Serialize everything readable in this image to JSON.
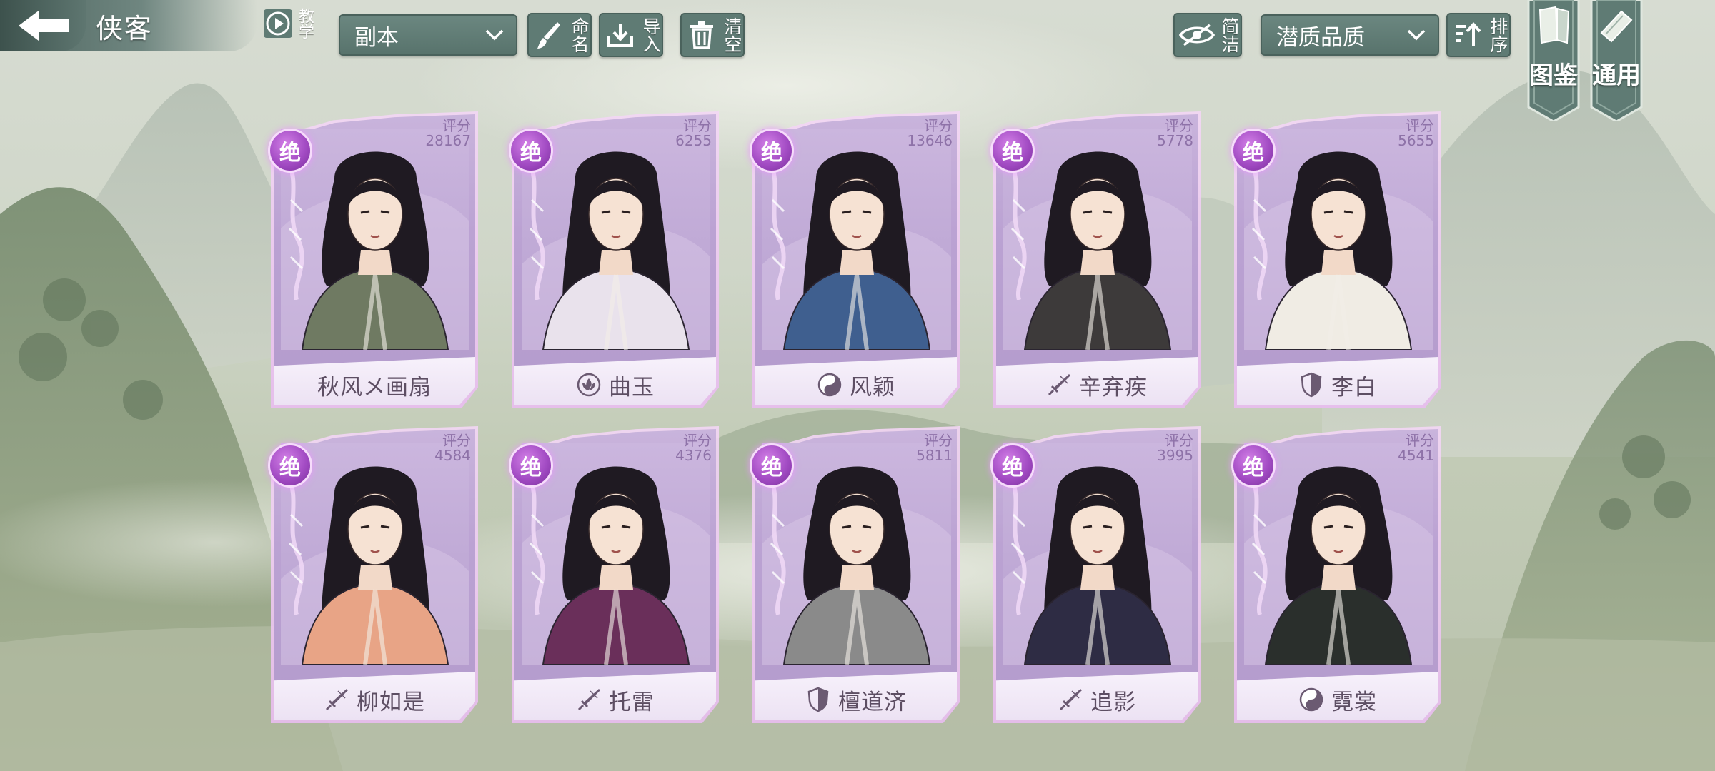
{
  "header": {
    "back_title": "侠客",
    "tutorial_label": "教学",
    "mode_select": {
      "selected": "副本"
    },
    "rename_label": "命名",
    "import_label": "导入",
    "clear_label": "清空",
    "simple_label": "简洁",
    "sort_select": {
      "selected": "潜质品质"
    },
    "order_label": "排序",
    "codex_label": "图鉴",
    "general_label": "通用"
  },
  "colors": {
    "toolbar": "#5f7b74",
    "card_frame": "#bba2d3",
    "rank_badge": "#a34cc4",
    "score_text": "#8e72a8",
    "name_text": "#5d4e63"
  },
  "heroes": [
    {
      "rank": "绝",
      "score_label": "评分",
      "score": "28167",
      "name": "秋风メ画扇",
      "sect_icon": "none",
      "art": "green-robed-swordsman",
      "theme": "#6f7a62"
    },
    {
      "rank": "绝",
      "score_label": "评分",
      "score": "6255",
      "name": "曲玉",
      "sect_icon": "lotus-icon",
      "art": "white-bride-maiden",
      "theme": "#e9e2ec"
    },
    {
      "rank": "绝",
      "score_label": "评分",
      "score": "13646",
      "name": "风颖",
      "sect_icon": "taiji-icon",
      "art": "blue-armored-heroine",
      "theme": "#3f5f8f"
    },
    {
      "rank": "绝",
      "score_label": "评分",
      "score": "5778",
      "name": "辛弃疾",
      "sect_icon": "sword-icon",
      "art": "dark-robed-swordsman",
      "theme": "#3d3a3a"
    },
    {
      "rank": "绝",
      "score_label": "评分",
      "score": "5655",
      "name": "李白",
      "sect_icon": "shield-icon",
      "art": "white-robed-poet",
      "theme": "#f0ece4"
    },
    {
      "rank": "绝",
      "score_label": "评分",
      "score": "4584",
      "name": "柳如是",
      "sect_icon": "sword-icon",
      "art": "peach-robed-lady",
      "theme": "#e8a486"
    },
    {
      "rank": "绝",
      "score_label": "评分",
      "score": "4376",
      "name": "托雷",
      "sect_icon": "sword-icon",
      "art": "fur-caped-warrior",
      "theme": "#6a2f5a"
    },
    {
      "rank": "绝",
      "score_label": "评分",
      "score": "5811",
      "name": "檀道济",
      "sect_icon": "shield-icon",
      "art": "silver-armored-general",
      "theme": "#8a8a8a"
    },
    {
      "rank": "绝",
      "score_label": "评分",
      "score": "3995",
      "name": "追影",
      "sect_icon": "sword-icon",
      "art": "dark-assassin-woman",
      "theme": "#2e2c44"
    },
    {
      "rank": "绝",
      "score_label": "评分",
      "score": "4541",
      "name": "霓裳",
      "sect_icon": "taiji-icon",
      "art": "masked-white-haired-figure",
      "theme": "#2a2f2c"
    }
  ]
}
